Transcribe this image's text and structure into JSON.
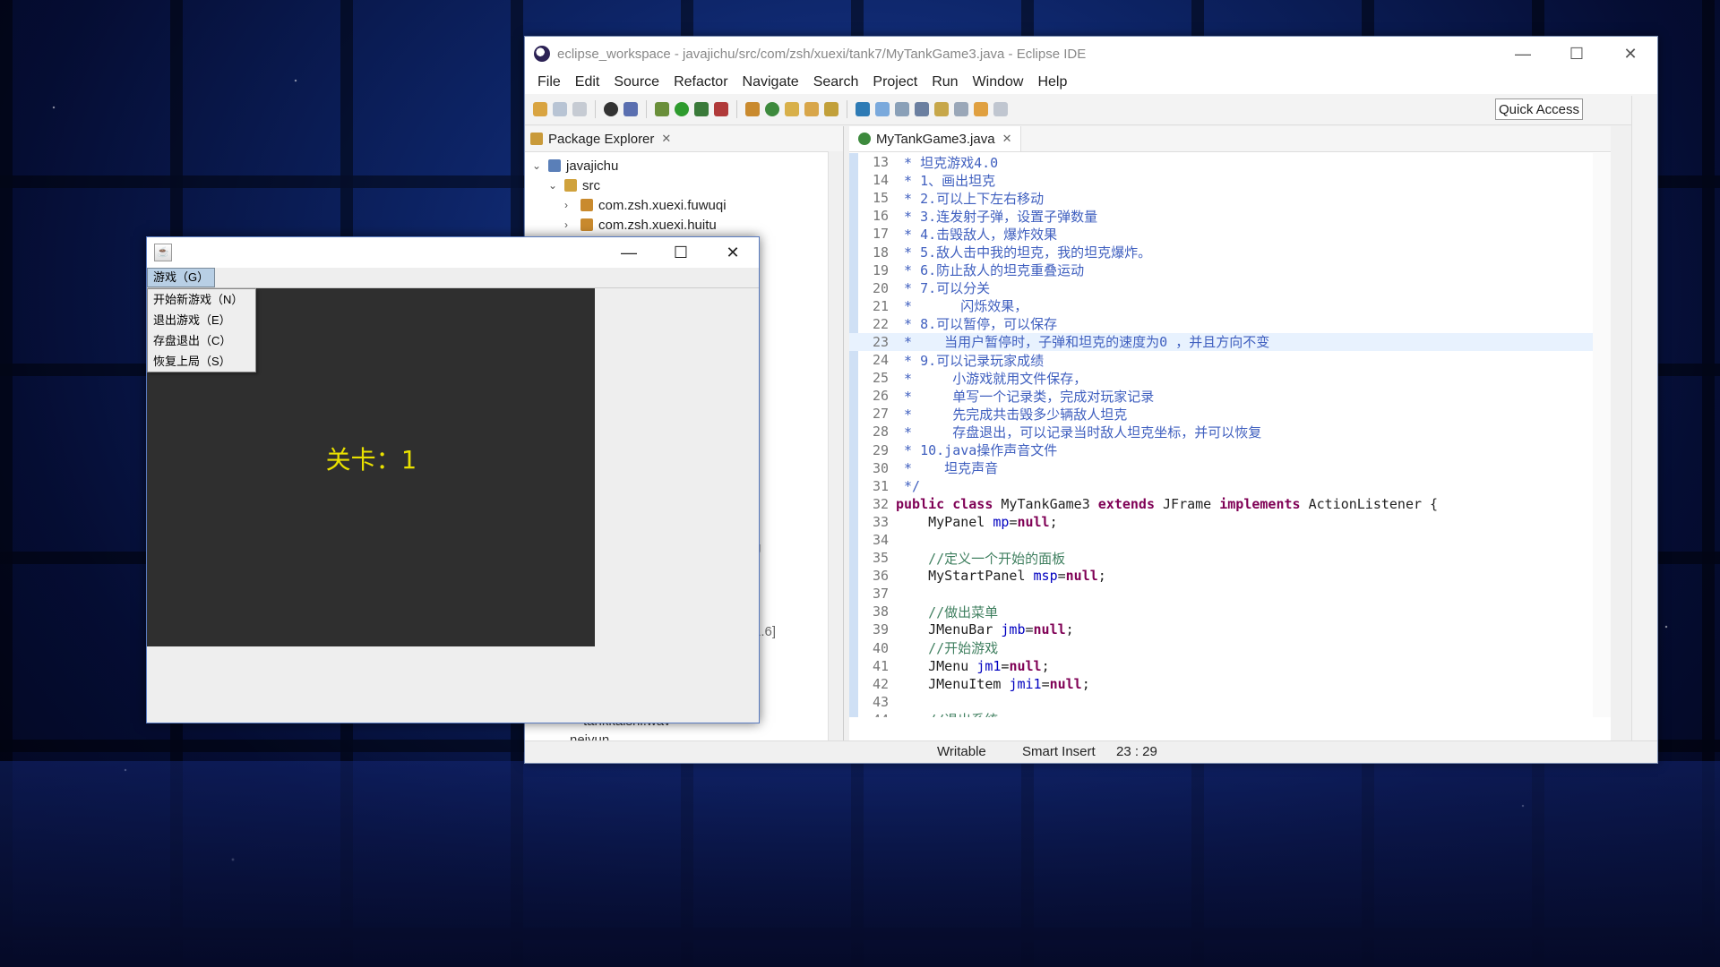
{
  "eclipse": {
    "title": "eclipse_workspace - javajichu/src/com/zsh/xuexi/tank7/MyTankGame3.java - Eclipse IDE",
    "menus": [
      "File",
      "Edit",
      "Source",
      "Refactor",
      "Navigate",
      "Search",
      "Project",
      "Run",
      "Window",
      "Help"
    ],
    "quick_access": "Quick Access",
    "package_explorer": {
      "tab_label": "Package Explorer",
      "tree": [
        {
          "label": "javajichu",
          "depth": 0,
          "expander": "v"
        },
        {
          "label": "src",
          "depth": 1,
          "expander": "v"
        },
        {
          "label": "com.zsh.xuexi.fuwuqi",
          "depth": 2,
          "expander": ">"
        },
        {
          "label": "com.zsh.xuexi.huitu",
          "depth": 2,
          "expander": ">"
        }
      ],
      "partial_fragments": [
        "g",
        "-1.6]",
        "tankkaishi.wav",
        "neiyun"
      ]
    },
    "editor": {
      "tab_label": "MyTankGame3.java",
      "lines": [
        {
          "n": "13",
          "segs": [
            {
              "t": " * 坦克游戏4.0",
              "c": "comment"
            }
          ]
        },
        {
          "n": "14",
          "segs": [
            {
              "t": " * 1、画出坦克",
              "c": "comment"
            }
          ]
        },
        {
          "n": "15",
          "segs": [
            {
              "t": " * 2.可以上下左右移动",
              "c": "comment"
            }
          ]
        },
        {
          "n": "16",
          "segs": [
            {
              "t": " * 3.连发射子弹，设置子弹数量",
              "c": "comment"
            }
          ]
        },
        {
          "n": "17",
          "segs": [
            {
              "t": " * 4.击毁敌人，爆炸效果",
              "c": "comment"
            }
          ]
        },
        {
          "n": "18",
          "segs": [
            {
              "t": " * 5.敌人击中我的坦克，我的坦克爆炸。",
              "c": "comment"
            }
          ]
        },
        {
          "n": "19",
          "segs": [
            {
              "t": " * 6.防止敌人的坦克重叠运动",
              "c": "comment"
            }
          ]
        },
        {
          "n": "20",
          "segs": [
            {
              "t": " * 7.可以分关",
              "c": "comment"
            }
          ]
        },
        {
          "n": "21",
          "segs": [
            {
              "t": " *      闪烁效果，",
              "c": "comment"
            }
          ]
        },
        {
          "n": "22",
          "segs": [
            {
              "t": " * 8.可以暂停，可以保存",
              "c": "comment"
            }
          ]
        },
        {
          "n": "23",
          "segs": [
            {
              "t": " *    当用户暂停时，子弹和坦克的速度为0 ，并且方向不变",
              "c": "comment"
            }
          ],
          "highlight": true
        },
        {
          "n": "24",
          "segs": [
            {
              "t": " * 9.可以记录玩家成绩",
              "c": "comment"
            }
          ]
        },
        {
          "n": "25",
          "segs": [
            {
              "t": " *     小游戏就用文件保存，",
              "c": "comment"
            }
          ]
        },
        {
          "n": "26",
          "segs": [
            {
              "t": " *     单写一个记录类，完成对玩家记录",
              "c": "comment"
            }
          ]
        },
        {
          "n": "27",
          "segs": [
            {
              "t": " *     先完成共击毁多少辆敌人坦克",
              "c": "comment"
            }
          ]
        },
        {
          "n": "28",
          "segs": [
            {
              "t": " *     存盘退出，可以记录当时敌人坦克坐标，并可以恢复",
              "c": "comment"
            }
          ]
        },
        {
          "n": "29",
          "segs": [
            {
              "t": " * 10.java操作声音文件",
              "c": "comment"
            }
          ]
        },
        {
          "n": "30",
          "segs": [
            {
              "t": " *    坦克声音",
              "c": "comment"
            }
          ]
        },
        {
          "n": "31",
          "segs": [
            {
              "t": " */",
              "c": "comment"
            }
          ]
        },
        {
          "n": "32",
          "segs": [
            {
              "t": "public class ",
              "c": "kw"
            },
            {
              "t": "MyTankGame3 ",
              "c": "code"
            },
            {
              "t": "extends ",
              "c": "kw"
            },
            {
              "t": "JFrame ",
              "c": "code"
            },
            {
              "t": "implements ",
              "c": "kw"
            },
            {
              "t": "ActionListener {",
              "c": "code"
            }
          ]
        },
        {
          "n": "33",
          "segs": [
            {
              "t": "    MyPanel ",
              "c": "code"
            },
            {
              "t": "mp",
              "c": "fld"
            },
            {
              "t": "=",
              "c": "code"
            },
            {
              "t": "null",
              "c": "kw"
            },
            {
              "t": ";",
              "c": "code"
            }
          ]
        },
        {
          "n": "34",
          "segs": [
            {
              "t": "",
              "c": "code"
            }
          ]
        },
        {
          "n": "35",
          "segs": [
            {
              "t": "    //定义一个开始的面板",
              "c": "linecomment"
            }
          ]
        },
        {
          "n": "36",
          "segs": [
            {
              "t": "    MyStartPanel ",
              "c": "code"
            },
            {
              "t": "msp",
              "c": "fld"
            },
            {
              "t": "=",
              "c": "code"
            },
            {
              "t": "null",
              "c": "kw"
            },
            {
              "t": ";",
              "c": "code"
            }
          ]
        },
        {
          "n": "37",
          "segs": [
            {
              "t": "",
              "c": "code"
            }
          ]
        },
        {
          "n": "38",
          "segs": [
            {
              "t": "    //做出菜单",
              "c": "linecomment"
            }
          ]
        },
        {
          "n": "39",
          "segs": [
            {
              "t": "    JMenuBar ",
              "c": "code"
            },
            {
              "t": "jmb",
              "c": "fld"
            },
            {
              "t": "=",
              "c": "code"
            },
            {
              "t": "null",
              "c": "kw"
            },
            {
              "t": ";",
              "c": "code"
            }
          ]
        },
        {
          "n": "40",
          "segs": [
            {
              "t": "    //开始游戏",
              "c": "linecomment"
            }
          ]
        },
        {
          "n": "41",
          "segs": [
            {
              "t": "    JMenu ",
              "c": "code"
            },
            {
              "t": "jm1",
              "c": "fld"
            },
            {
              "t": "=",
              "c": "code"
            },
            {
              "t": "null",
              "c": "kw"
            },
            {
              "t": ";",
              "c": "code"
            }
          ]
        },
        {
          "n": "42",
          "segs": [
            {
              "t": "    JMenuItem ",
              "c": "code"
            },
            {
              "t": "jmi1",
              "c": "fld"
            },
            {
              "t": "=",
              "c": "code"
            },
            {
              "t": "null",
              "c": "kw"
            },
            {
              "t": ";",
              "c": "code"
            }
          ]
        },
        {
          "n": "43",
          "segs": [
            {
              "t": "",
              "c": "code"
            }
          ]
        },
        {
          "n": "44",
          "segs": [
            {
              "t": "    //退出系统",
              "c": "linecomment"
            }
          ]
        }
      ]
    },
    "status": {
      "writable": "Writable",
      "insert_mode": "Smart Insert",
      "position": "23 : 29"
    }
  },
  "game": {
    "menu_label": "游戏（G）",
    "menu_items": [
      "开始新游戏（N）",
      "退出游戏（E）",
      "存盘退出（C）",
      "恢复上局（S）"
    ],
    "level_text": "关卡：1"
  }
}
